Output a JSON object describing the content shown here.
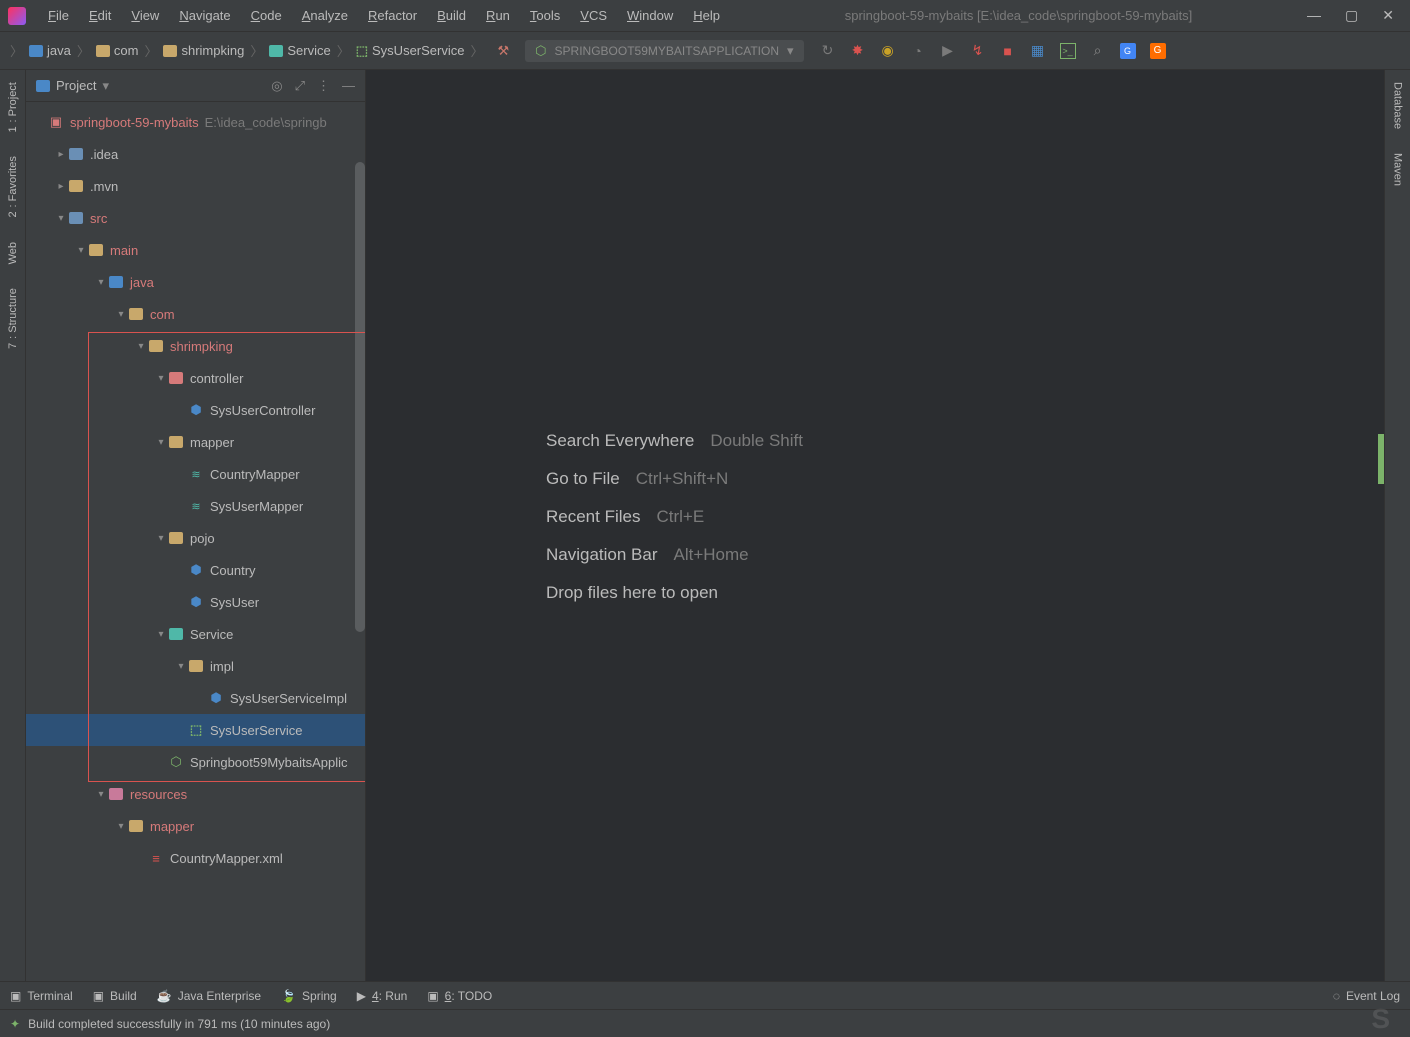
{
  "title": "springboot-59-mybaits [E:\\idea_code\\springboot-59-mybaits]",
  "menu": [
    "File",
    "Edit",
    "View",
    "Navigate",
    "Code",
    "Analyze",
    "Refactor",
    "Build",
    "Run",
    "Tools",
    "VCS",
    "Window",
    "Help"
  ],
  "breadcrumb": [
    {
      "icon": "folder-blue",
      "label": "java"
    },
    {
      "icon": "folder",
      "label": "com"
    },
    {
      "icon": "folder",
      "label": "shrimpking"
    },
    {
      "icon": "folder-teal",
      "label": "Service"
    },
    {
      "icon": "interface",
      "label": "SysUserService"
    }
  ],
  "runConfig": "SPRINGBOOT59MYBAITSAPPLICATION",
  "projectPanel": {
    "title": "Project"
  },
  "tree": [
    {
      "d": 0,
      "a": "",
      "icon": "proj",
      "label": "springboot-59-mybaits",
      "hl": true,
      "path": "E:\\idea_code\\springb"
    },
    {
      "d": 1,
      "a": ">",
      "icon": "folder-cfg",
      "label": ".idea"
    },
    {
      "d": 1,
      "a": ">",
      "icon": "folder",
      "label": ".mvn"
    },
    {
      "d": 1,
      "a": "v",
      "icon": "folder-src",
      "label": "src",
      "hl": true
    },
    {
      "d": 2,
      "a": "v",
      "icon": "folder",
      "label": "main",
      "hl": true
    },
    {
      "d": 3,
      "a": "v",
      "icon": "folder-blue",
      "label": "java",
      "hl": true
    },
    {
      "d": 4,
      "a": "v",
      "icon": "folder",
      "label": "com",
      "hl": true
    },
    {
      "d": 5,
      "a": "v",
      "icon": "folder",
      "label": "shrimpking",
      "hl": true
    },
    {
      "d": 6,
      "a": "v",
      "icon": "folder-ctrl",
      "label": "controller"
    },
    {
      "d": 7,
      "a": "",
      "icon": "class",
      "label": "SysUserController"
    },
    {
      "d": 6,
      "a": "v",
      "icon": "folder",
      "label": "mapper"
    },
    {
      "d": 7,
      "a": "",
      "icon": "db",
      "label": "CountryMapper"
    },
    {
      "d": 7,
      "a": "",
      "icon": "db",
      "label": "SysUserMapper"
    },
    {
      "d": 6,
      "a": "v",
      "icon": "folder",
      "label": "pojo"
    },
    {
      "d": 7,
      "a": "",
      "icon": "class",
      "label": "Country"
    },
    {
      "d": 7,
      "a": "",
      "icon": "class",
      "label": "SysUser"
    },
    {
      "d": 6,
      "a": "v",
      "icon": "folder-teal",
      "label": "Service"
    },
    {
      "d": 7,
      "a": "v",
      "icon": "folder",
      "label": "impl"
    },
    {
      "d": 8,
      "a": "",
      "icon": "class",
      "label": "SysUserServiceImpl"
    },
    {
      "d": 7,
      "a": "",
      "icon": "interface",
      "label": "SysUserService",
      "sel": true
    },
    {
      "d": 6,
      "a": "",
      "icon": "spring",
      "label": "Springboot59MybaitsApplic"
    },
    {
      "d": 3,
      "a": "v",
      "icon": "folder-res",
      "label": "resources",
      "hl": true
    },
    {
      "d": 4,
      "a": "v",
      "icon": "folder",
      "label": "mapper",
      "hl": true
    },
    {
      "d": 5,
      "a": "",
      "icon": "xml",
      "label": "CountryMapper.xml"
    }
  ],
  "hints": [
    {
      "label": "Search Everywhere",
      "key": "Double Shift"
    },
    {
      "label": "Go to File",
      "key": "Ctrl+Shift+N"
    },
    {
      "label": "Recent Files",
      "key": "Ctrl+E"
    },
    {
      "label": "Navigation Bar",
      "key": "Alt+Home"
    },
    {
      "label": "Drop files here to open",
      "key": ""
    }
  ],
  "leftGutter": [
    {
      "num": "1",
      "label": "Project"
    },
    {
      "num": "2",
      "label": "Favorites"
    },
    {
      "num": "",
      "label": "Web"
    },
    {
      "num": "7",
      "label": "Structure"
    }
  ],
  "rightGutter": [
    "Database",
    "Maven"
  ],
  "bottomBar": [
    {
      "icon": "▣",
      "label": "Terminal"
    },
    {
      "icon": "▣",
      "label": "Build"
    },
    {
      "icon": "☕",
      "label": "Java Enterprise"
    },
    {
      "icon": "🍃",
      "label": "Spring"
    },
    {
      "icon": "▶",
      "label": "4: Run",
      "u": "4"
    },
    {
      "icon": "▣",
      "label": "6: TODO",
      "u": "6"
    }
  ],
  "eventLog": "Event Log",
  "status": "Build completed successfully in 791 ms (10 minutes ago)"
}
